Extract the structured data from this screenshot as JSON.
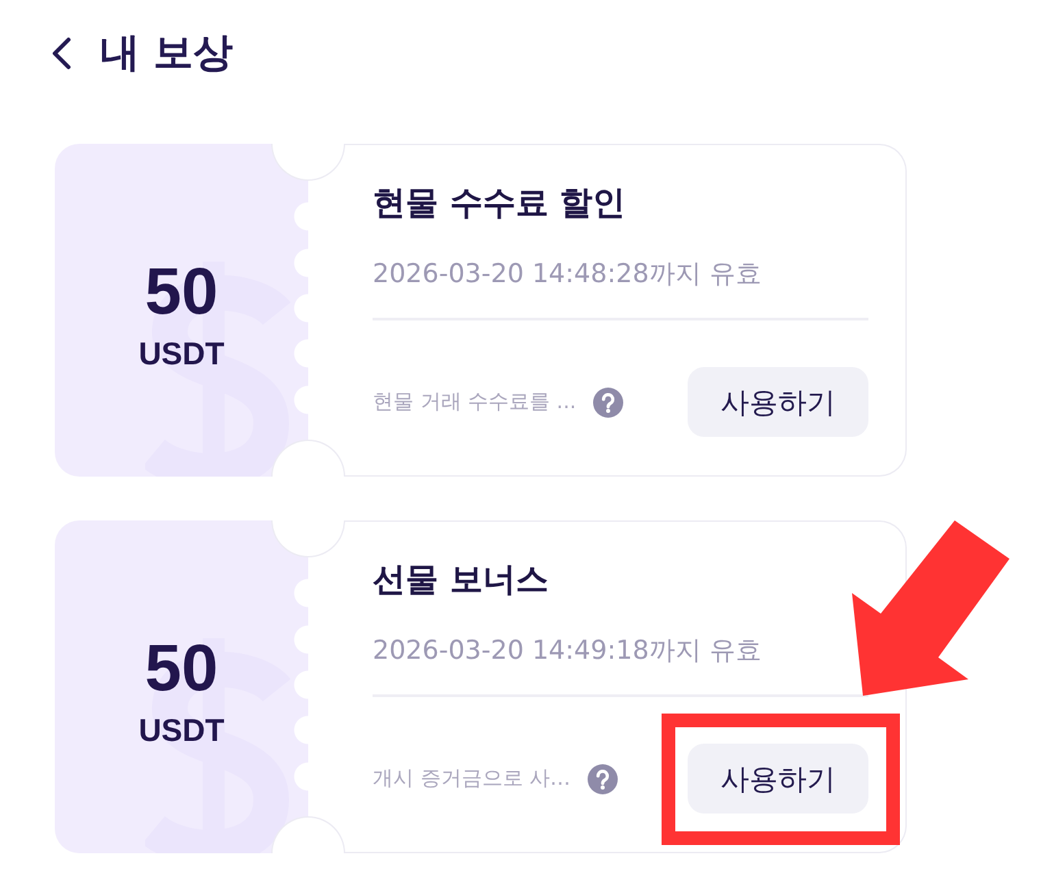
{
  "header": {
    "title": "내 보상"
  },
  "coupons": [
    {
      "amount": "50",
      "unit": "USDT",
      "title": "현물 수수료 할인",
      "validity": "2026-03-20 14:48:28까지 유효",
      "description": "현물 거래 수수료를 ...",
      "button": "사용하기",
      "highlighted": false
    },
    {
      "amount": "50",
      "unit": "USDT",
      "title": "선물 보너스",
      "validity": "2026-03-20 14:49:18까지 유효",
      "description": "개시 증거금으로 사…",
      "button": "사용하기",
      "highlighted": true
    }
  ]
}
